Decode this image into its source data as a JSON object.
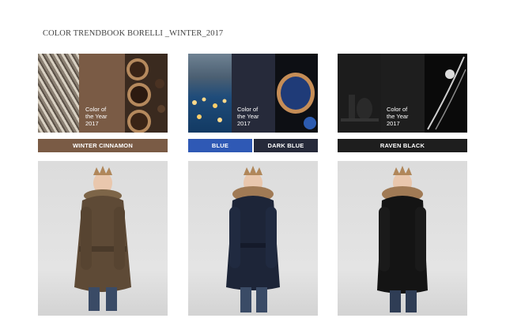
{
  "page": {
    "title": "COLOR TRENDBOOK BORELLI _WINTER_2017"
  },
  "swatch_text": "Color of the Year 2017",
  "columns": [
    {
      "labels": [
        "WINTER CINNAMON"
      ],
      "label_colors": [
        "#7a5b45"
      ],
      "main_color": "#7a5b45",
      "coat_color": "#5e4a36"
    },
    {
      "labels": [
        "BLUE",
        "DARK BLUE"
      ],
      "label_colors": [
        "#2f59b5",
        "#262a3a"
      ],
      "main_color": "#262a3a",
      "coat_color": "#1d2538"
    },
    {
      "labels": [
        "RAVEN BLACK"
      ],
      "label_colors": [
        "#1e1e1e"
      ],
      "main_color": "#1e1e1e",
      "coat_color": "#141414"
    }
  ]
}
